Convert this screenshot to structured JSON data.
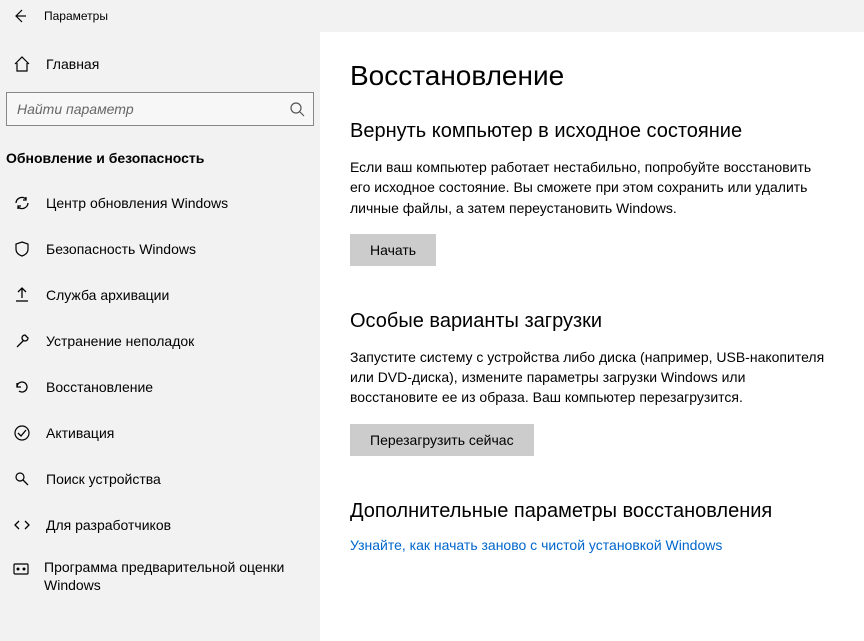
{
  "titlebar": {
    "label": "Параметры"
  },
  "sidebar": {
    "home": "Главная",
    "searchPlaceholder": "Найти параметр",
    "sectionTitle": "Обновление и безопасность",
    "items": [
      {
        "label": "Центр обновления Windows"
      },
      {
        "label": "Безопасность Windows"
      },
      {
        "label": "Служба архивации"
      },
      {
        "label": "Устранение неполадок"
      },
      {
        "label": "Восстановление"
      },
      {
        "label": "Активация"
      },
      {
        "label": "Поиск устройства"
      },
      {
        "label": "Для разработчиков"
      },
      {
        "label": "Программа предварительной оценки Windows"
      }
    ]
  },
  "main": {
    "title": "Восстановление",
    "reset": {
      "heading": "Вернуть компьютер в исходное состояние",
      "body": "Если ваш компьютер работает нестабильно, попробуйте восстановить его исходное состояние. Вы сможете при этом сохранить или удалить личные файлы, а затем переустановить Windows.",
      "button": "Начать"
    },
    "advanced": {
      "heading": "Особые варианты загрузки",
      "body": "Запустите систему с устройства либо диска (например, USB-накопителя или DVD-диска), измените параметры загрузки Windows или восстановите ее из образа. Ваш компьютер перезагрузится.",
      "button": "Перезагрузить сейчас"
    },
    "more": {
      "heading": "Дополнительные параметры восстановления",
      "link": "Узнайте, как начать заново с чистой установкой Windows"
    }
  }
}
